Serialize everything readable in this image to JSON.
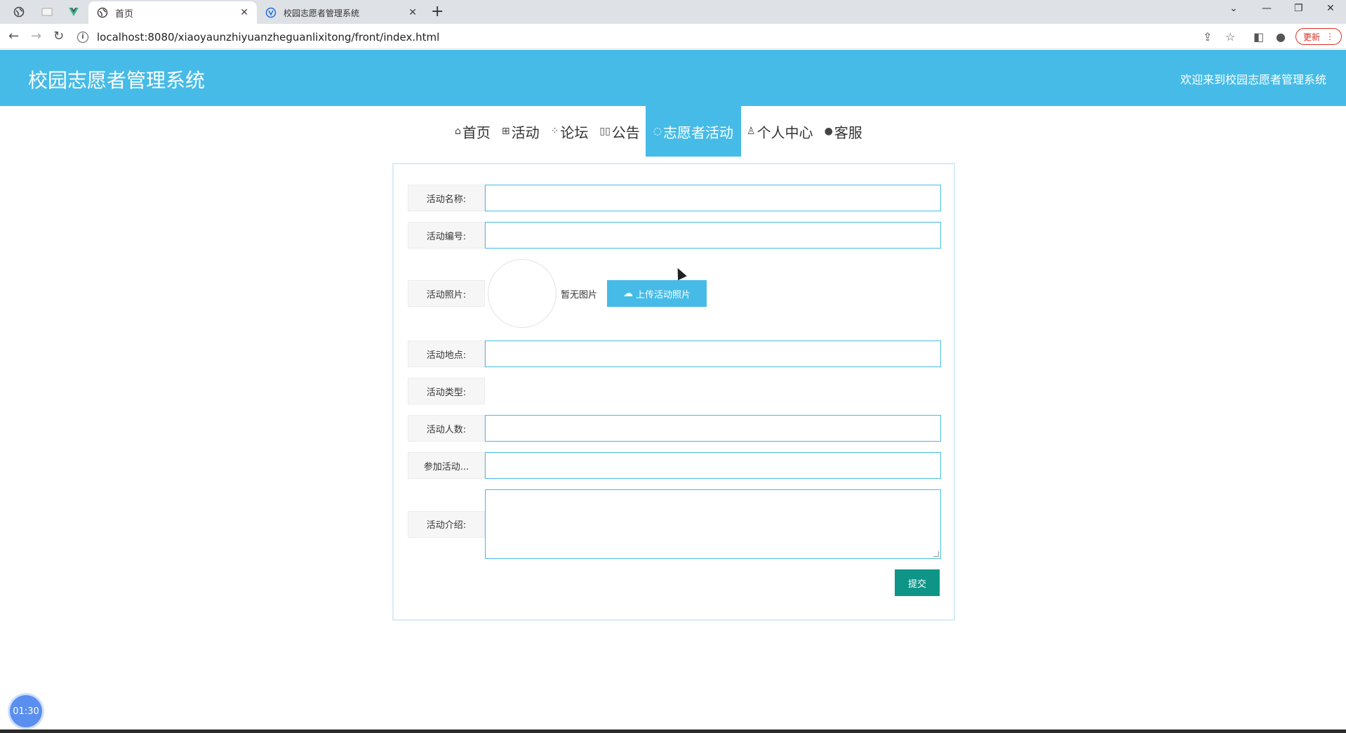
{
  "browser": {
    "tabs": [
      {
        "title": "首页",
        "active": true
      },
      {
        "title": "校园志愿者管理系统",
        "active": false
      }
    ],
    "new_tab": "+",
    "url": "localhost:8080/xiaoyaunzhiyuanzheguanlixitong/front/index.html",
    "update_label": "更新"
  },
  "header": {
    "title": "校园志愿者管理系统",
    "welcome": "欢迎来到校园志愿者管理系统"
  },
  "nav": {
    "items": [
      {
        "label": "首页",
        "icon": "home-icon",
        "glyph": "⌂"
      },
      {
        "label": "活动",
        "icon": "grid-icon",
        "glyph": "⊞"
      },
      {
        "label": "论坛",
        "icon": "blocks-icon",
        "glyph": "⁘"
      },
      {
        "label": "公告",
        "icon": "columns-icon",
        "glyph": "▯▯"
      },
      {
        "label": "志愿者活动",
        "icon": "chat-icon",
        "glyph": "◌"
      },
      {
        "label": "个人中心",
        "icon": "user-icon",
        "glyph": "♙"
      },
      {
        "label": "客服",
        "icon": "service-icon",
        "glyph": "●"
      }
    ],
    "active_index": 4
  },
  "form": {
    "name_label": "活动名称:",
    "code_label": "活动编号:",
    "photo_label": "活动照片:",
    "no_image": "暂无图片",
    "upload_label": "上传活动照片",
    "location_label": "活动地点:",
    "type_label": "活动类型:",
    "count_label": "活动人数:",
    "join_label": "参加活动...",
    "intro_label": "活动介绍:",
    "submit_label": "提交"
  },
  "timer": "01:30",
  "colors": {
    "header_bg": "#46bbe7",
    "submit_bg": "#0e9588"
  }
}
